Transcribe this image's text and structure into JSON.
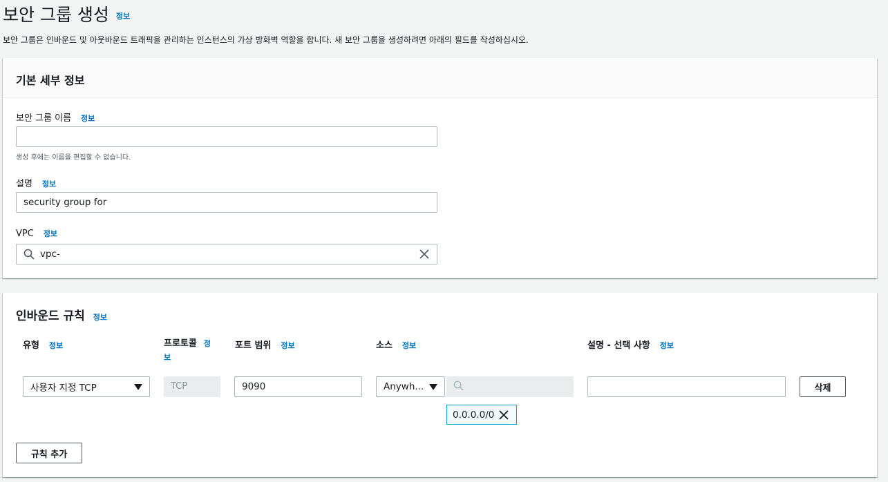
{
  "page": {
    "title": "보안 그룹 생성",
    "info": "정보",
    "description": "보안 그룹은 인바운드 및 아웃바운드 트래픽을 관리하는 인스턴스의 가상 방화벽 역할을 합니다. 새 보안 그룹을 생성하려면 아래의 필드를 작성하십시오."
  },
  "basic": {
    "heading": "기본 세부 정보",
    "name_label": "보안 그룹 이름",
    "name_info": "정보",
    "name_value": "",
    "name_hint": "생성 후에는 이름을 편집할 수 없습니다.",
    "desc_label": "설명",
    "desc_info": "정보",
    "desc_value": "security group for",
    "vpc_label": "VPC",
    "vpc_info": "정보",
    "vpc_value": "vpc-"
  },
  "inbound": {
    "heading": "인바운드 규칙",
    "info": "정보",
    "columns": {
      "type": "유형",
      "protocol": "프로토콜",
      "port": "포트 범위",
      "source": "소스",
      "desc": "설명 - 선택 사항",
      "info": "정보",
      "protocol_info_a": "정",
      "protocol_info_b": "보"
    },
    "rule": {
      "type": "사용자 지정 TCP",
      "protocol": "TCP",
      "port": "9090",
      "source": "Anywh...",
      "source_search": "",
      "cidr": "0.0.0.0/0",
      "desc": "",
      "delete": "삭제"
    },
    "add_rule": "규칙 추가"
  }
}
